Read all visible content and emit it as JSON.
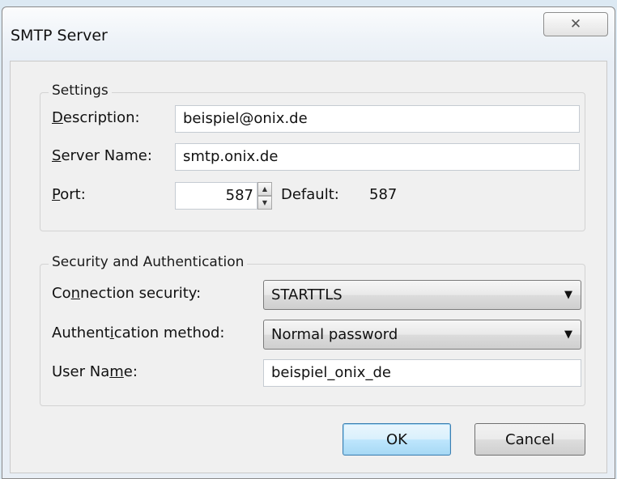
{
  "dialog": {
    "title": "SMTP Server",
    "close_symbol": "✕"
  },
  "settings": {
    "legend": "Settings",
    "description_label": {
      "mnemonic": "D",
      "rest": "escription:"
    },
    "description_value": "beispiel@onix.de",
    "server_label": {
      "mnemonic": "S",
      "rest": "erver Name:"
    },
    "server_value": "smtp.onix.de",
    "port_label": {
      "mnemonic": "P",
      "rest": "ort:"
    },
    "port_value": "587",
    "default_label": "Default:",
    "default_value": "587"
  },
  "security": {
    "legend": "Security and Authentication",
    "connection_label": {
      "before": "Co",
      "mnemonic": "n",
      "after": "nection security:"
    },
    "connection_value": "STARTTLS",
    "auth_label": {
      "before": "Authent",
      "mnemonic": "i",
      "after": "cation method:"
    },
    "auth_value": "Normal password",
    "username_label": {
      "before": "User Na",
      "mnemonic": "m",
      "after": "e:"
    },
    "username_value": "beispiel_onix_de"
  },
  "buttons": {
    "ok": "OK",
    "cancel": "Cancel"
  },
  "icons": {
    "close": "close-icon",
    "spin_up": "triangle-up-icon",
    "spin_down": "triangle-down-icon",
    "dropdown": "triangle-down-icon"
  },
  "colors": {
    "default_button_border": "#3c7fb1",
    "dialog_background": "#f0f0f0"
  }
}
